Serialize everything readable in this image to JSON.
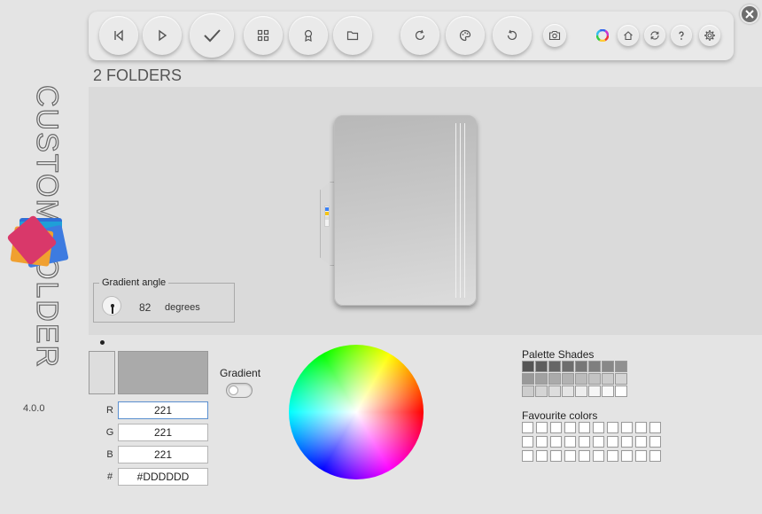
{
  "app": {
    "title": "CUSTOM FOLDER",
    "version": "4.0.0"
  },
  "toolbar": {
    "buttons": [
      {
        "name": "previous-button",
        "icon": "skip-back-icon"
      },
      {
        "name": "play-button",
        "icon": "play-icon"
      },
      {
        "name": "apply-button",
        "icon": "check-icon"
      },
      {
        "name": "grid-button",
        "icon": "grid-icon"
      },
      {
        "name": "badge-button",
        "icon": "award-icon"
      },
      {
        "name": "folder-button",
        "icon": "folder-icon"
      },
      {
        "name": "refresh-button",
        "icon": "refresh-icon"
      },
      {
        "name": "palette-button",
        "icon": "palette-icon"
      },
      {
        "name": "undo-button",
        "icon": "undo-icon"
      },
      {
        "name": "screenshot-button",
        "icon": "camera-icon"
      },
      {
        "name": "color-wheel-button",
        "icon": "color-wheel-icon"
      },
      {
        "name": "home-button",
        "icon": "home-icon"
      },
      {
        "name": "sync-button",
        "icon": "sync-icon"
      },
      {
        "name": "help-button",
        "icon": "help-icon"
      },
      {
        "name": "settings-button",
        "icon": "gear-icon"
      }
    ]
  },
  "folders_label": "2 FOLDERS",
  "gradient_angle": {
    "legend": "Gradient angle",
    "value": "82",
    "unit": "degrees"
  },
  "color_fields": {
    "r_label": "R",
    "r": "221",
    "g_label": "G",
    "g": "221",
    "b_label": "B",
    "b": "221",
    "hex_label": "#",
    "hex": "#DDDDDD"
  },
  "swatches": {
    "old": "#dddddd",
    "new": "#aaaaaa"
  },
  "gradient_label": "Gradient",
  "gradient_enabled": false,
  "palette_shades_label": "Palette Shades",
  "favourite_colors_label": "Favourite colors",
  "palette_shades": [
    "#555555",
    "#5e5e5e",
    "#666666",
    "#6e6e6e",
    "#777777",
    "#7f7f7f",
    "#888888",
    "#909090",
    "#999999",
    "#a1a1a1",
    "#aaaaaa",
    "#b2b2b2",
    "#bbbbbb",
    "#c3c3c3",
    "#cccccc",
    "#d4d4d4",
    "#cdcdcd",
    "#d5d5d5",
    "#dddddd",
    "#e5e5e5",
    "#eeeeee",
    "#f6f6f6",
    "#fafafa",
    "#ffffff"
  ],
  "favourite_colors": [
    "#ffffff",
    "#ffffff",
    "#ffffff",
    "#ffffff",
    "#ffffff",
    "#ffffff",
    "#ffffff",
    "#ffffff",
    "#ffffff",
    "#ffffff",
    "#ffffff",
    "#ffffff",
    "#ffffff",
    "#ffffff",
    "#ffffff",
    "#ffffff",
    "#ffffff",
    "#ffffff",
    "#ffffff",
    "#ffffff",
    "#ffffff",
    "#ffffff",
    "#ffffff",
    "#ffffff",
    "#ffffff",
    "#ffffff",
    "#ffffff",
    "#ffffff",
    "#ffffff",
    "#ffffff"
  ]
}
